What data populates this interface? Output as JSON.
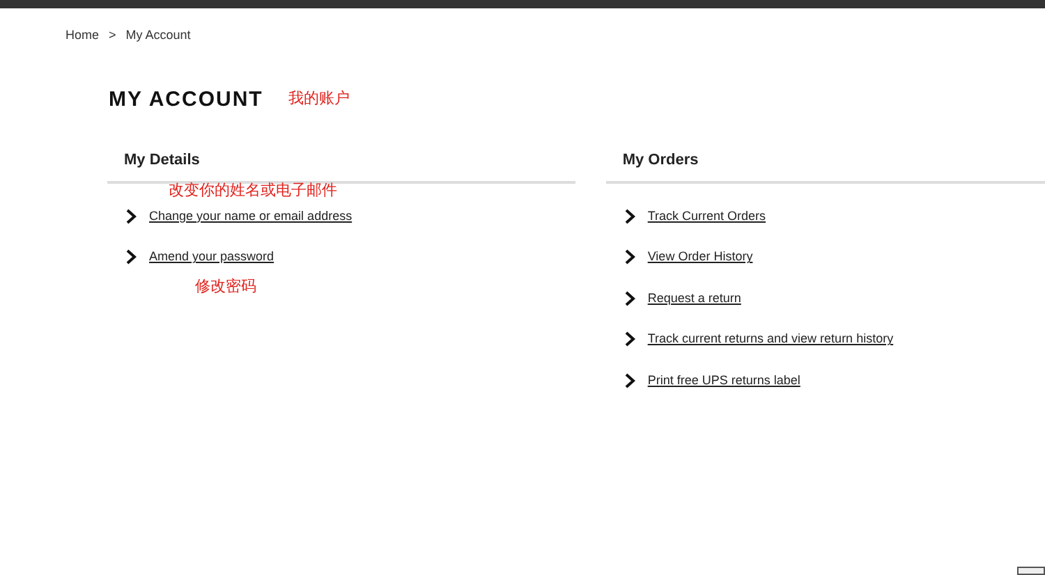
{
  "breadcrumb": [
    {
      "label": "Home"
    },
    {
      "label": "My Account"
    }
  ],
  "breadcrumb_separator": ">",
  "title": "MY ACCOUNT",
  "title_note": "我的账户",
  "sections": [
    {
      "heading": "My Details",
      "links": [
        {
          "label": "Change your name or email address",
          "note": "改变你的姓名或电子邮件"
        },
        {
          "label": "Amend your password",
          "note_below": "修改密码"
        }
      ]
    },
    {
      "heading": "My Orders",
      "links": [
        {
          "label": "Track Current Orders"
        },
        {
          "label": "View Order History"
        },
        {
          "label": "Request a return"
        },
        {
          "label": "Track current returns and view return history"
        },
        {
          "label": "Print free UPS returns label"
        }
      ]
    }
  ]
}
